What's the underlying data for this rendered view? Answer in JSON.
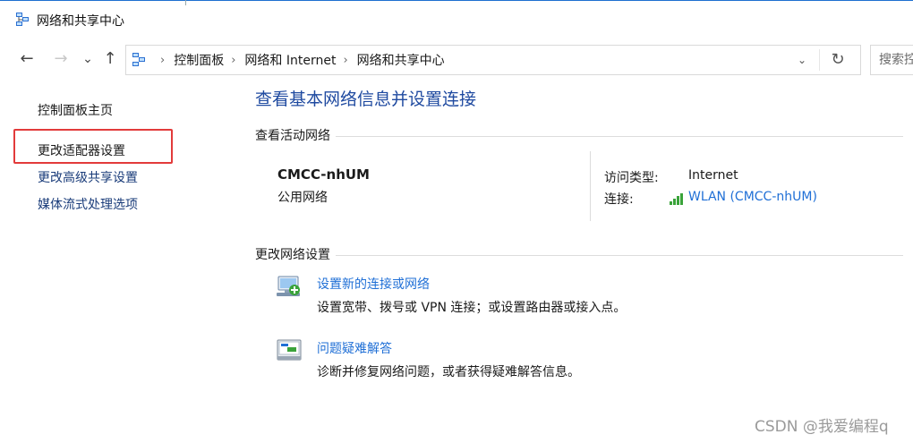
{
  "window": {
    "title": "网络和共享中心",
    "icon": "network-icon"
  },
  "nav": {
    "back": "←",
    "forward": "→",
    "recent": "⌄",
    "up": "↑"
  },
  "address": {
    "icon": "control-panel-icon",
    "crumbs": [
      "控制面板",
      "网络和 Internet",
      "网络和共享中心"
    ],
    "separator": "›",
    "dropdown": "⌄",
    "refresh": "↻"
  },
  "search": {
    "placeholder": "搜索控"
  },
  "sidebar": {
    "items": [
      {
        "label": "控制面板主页"
      },
      {
        "label": "更改适配器设置"
      },
      {
        "label": "更改高级共享设置"
      },
      {
        "label": "媒体流式处理选项"
      }
    ]
  },
  "main": {
    "heading": "查看基本网络信息并设置连接",
    "active_section": "查看活动网络",
    "network": {
      "name": "CMCC-nhUM",
      "type": "公用网络",
      "access_label": "访问类型:",
      "access_value": "Internet",
      "connection_label": "连接:",
      "connection_value": "WLAN (CMCC-nhUM)"
    },
    "change_section": "更改网络设置",
    "tasks": [
      {
        "icon": "new-connection-icon",
        "title": "设置新的连接或网络",
        "desc": "设置宽带、拨号或 VPN 连接；或设置路由器或接入点。"
      },
      {
        "icon": "troubleshoot-icon",
        "title": "问题疑难解答",
        "desc": "诊断并修复网络问题，或者获得疑难解答信息。"
      }
    ]
  },
  "watermark": "CSDN @我爱编程q",
  "colors": {
    "link": "#1f6fd6",
    "heading": "#1f4aa0",
    "highlight": "#e23b3b",
    "signal": "#3aa33a"
  }
}
